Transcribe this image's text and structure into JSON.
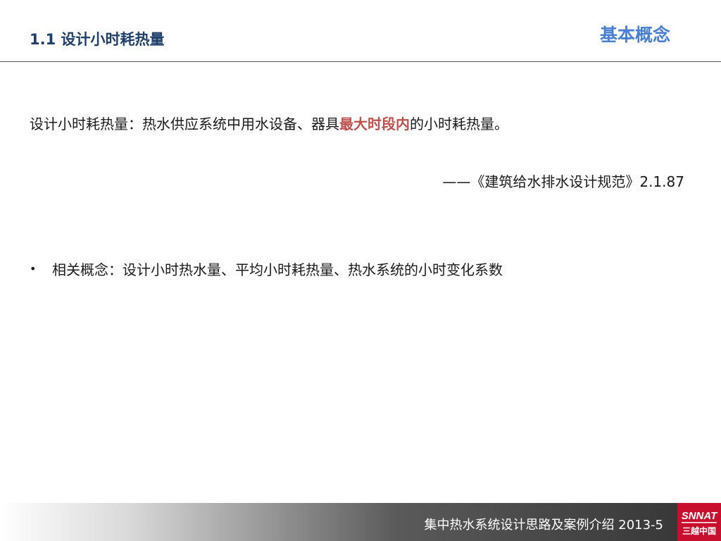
{
  "header": {
    "title": "1.1 设计小时耗热量",
    "section": "基本概念"
  },
  "definition": {
    "before": "设计小时耗热量：热水供应系统中用水设备、器具",
    "highlight": "最大时段内",
    "after": "的小时耗热量。"
  },
  "citation": "——《建筑给水排水设计规范》2.1.87",
  "related": {
    "bullet": "•",
    "text": "相关概念：设计小时热水量、平均小时耗热量、热水系统的小时变化系数"
  },
  "footer": {
    "text": "集中热水系统设计思路及案例介绍  2013-5",
    "logo_text_top": "SNNAT",
    "logo_text_bottom": "三越中国"
  },
  "colors": {
    "title": "#1f3f6b",
    "section": "#4a7fd0",
    "highlight": "#c0504d",
    "logo_bg": "#c8102e"
  }
}
